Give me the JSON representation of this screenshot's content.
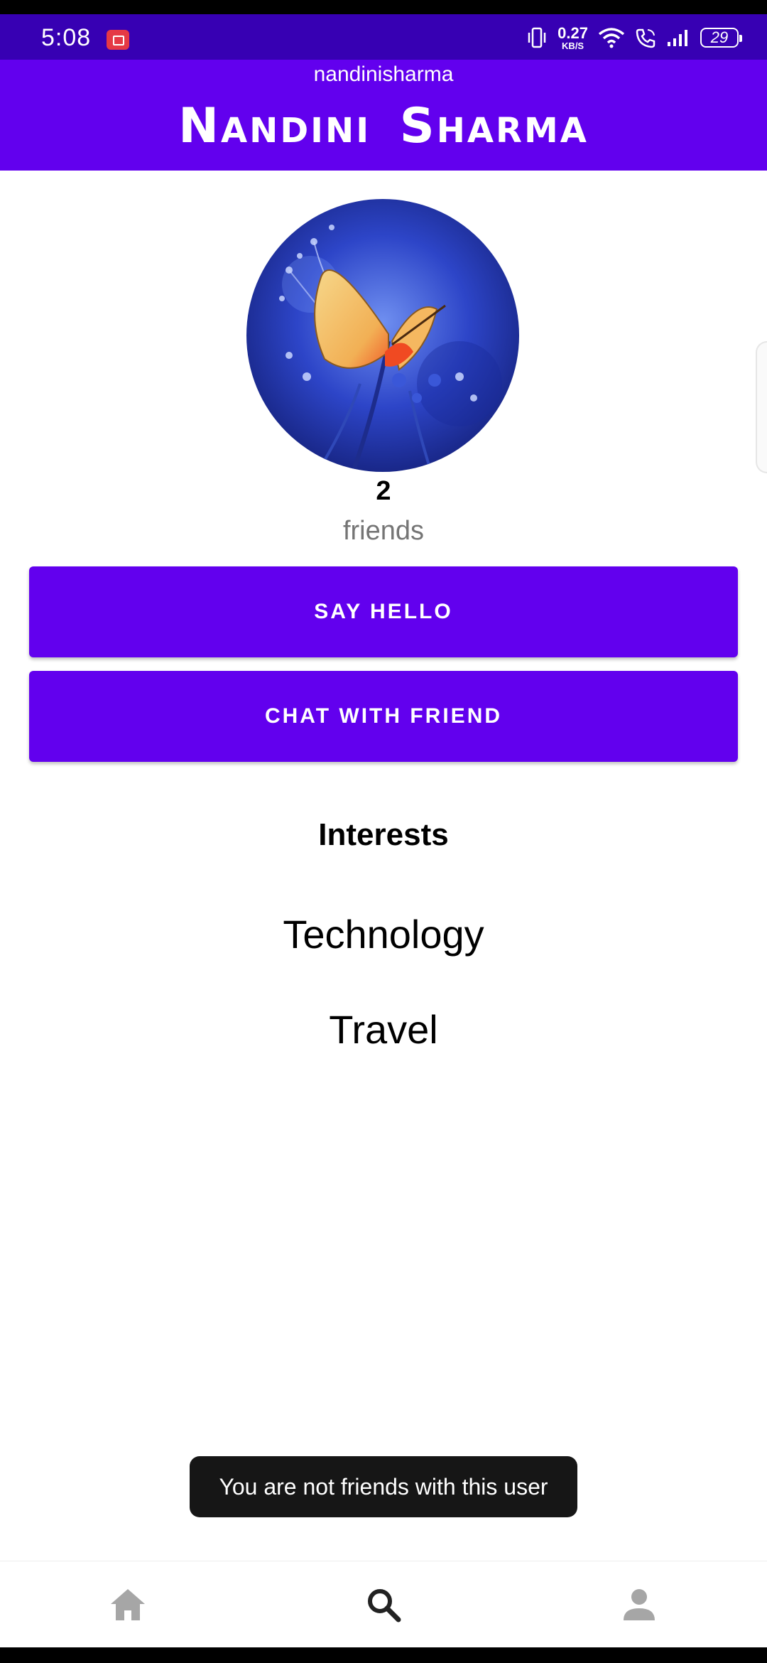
{
  "status_bar": {
    "time": "5:08",
    "net_speed_value": "0.27",
    "net_speed_unit": "KB/S",
    "battery": "29",
    "icons": [
      "screen-record-icon",
      "vibrate-icon",
      "wifi-icon",
      "wifi-calling-icon",
      "signal-icon",
      "battery-icon"
    ]
  },
  "header": {
    "username": "nandinisharma",
    "display_name": "Nandini  Sharma"
  },
  "profile": {
    "friend_count": "2",
    "friend_label": "friends"
  },
  "actions": {
    "say_hello_label": "SAY HELLO",
    "chat_label": "CHAT WITH FRIEND"
  },
  "interests": {
    "title": "Interests",
    "items": [
      "Technology",
      "Travel"
    ]
  },
  "toast": {
    "message": "You are not friends with this user"
  },
  "bottom_nav": {
    "items": [
      {
        "icon": "home-icon",
        "active": false
      },
      {
        "icon": "search-icon",
        "active": true
      },
      {
        "icon": "person-icon",
        "active": false
      }
    ]
  },
  "colors": {
    "status_bar": "#3700b3",
    "primary": "#6200ee",
    "toast_bg": "#161616",
    "nav_inactive": "#a6a6a6",
    "nav_active": "#222222"
  }
}
